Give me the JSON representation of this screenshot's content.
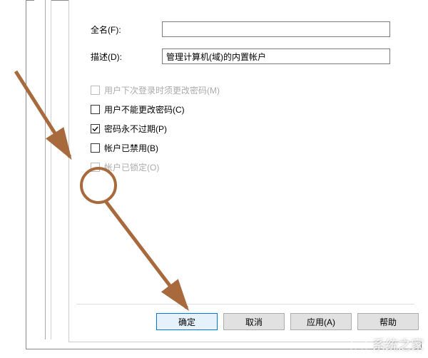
{
  "form": {
    "fullname_label": "全名(F):",
    "fullname_value": "",
    "description_label": "描述(D):",
    "description_value": "管理计算机(域)的内置帐户"
  },
  "checkboxes": {
    "must_change": {
      "label": "用户下次登录时须更改密码(M)",
      "checked": false,
      "enabled": false
    },
    "cannot_change": {
      "label": "用户不能更改密码(C)",
      "checked": false,
      "enabled": true
    },
    "never_expires": {
      "label": "密码永不过期(P)",
      "checked": true,
      "enabled": true
    },
    "disabled": {
      "label": "帐户已禁用(B)",
      "checked": false,
      "enabled": true
    },
    "locked": {
      "label": "帐户已锁定(O)",
      "checked": false,
      "enabled": false
    }
  },
  "buttons": {
    "ok": "确定",
    "cancel": "取消",
    "apply": "应用(A)",
    "help": "帮助"
  },
  "watermark": "系统之家",
  "annotation": {
    "circle_target": "locked-checkbox",
    "arrow1_target": "locked-checkbox-area",
    "arrow2_target": "ok-button"
  },
  "colors": {
    "annotation": "#a86a3d",
    "primary_border": "#0078d7"
  }
}
